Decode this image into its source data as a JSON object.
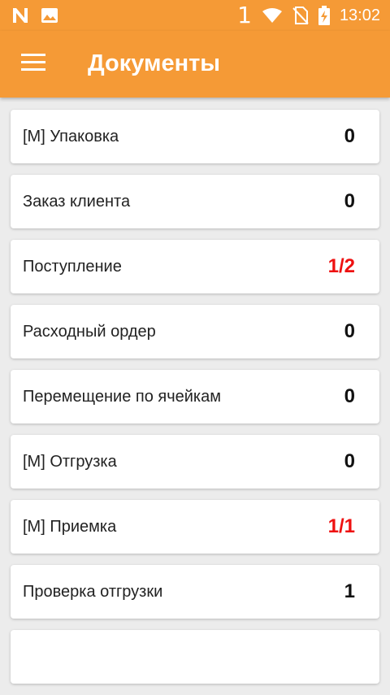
{
  "status_bar": {
    "notification_number": "1",
    "time": "13:02",
    "icons": [
      "n-notification-icon",
      "image-notification-icon",
      "wifi-icon",
      "no-sim-icon",
      "battery-charging-icon"
    ]
  },
  "app_bar": {
    "title": "Документы",
    "menu_icon": "hamburger-menu-icon"
  },
  "documents": [
    {
      "label": "[М] Упаковка",
      "count": "0",
      "alert": false
    },
    {
      "label": "Заказ клиента",
      "count": "0",
      "alert": false
    },
    {
      "label": "Поступление",
      "count": "1/2",
      "alert": true
    },
    {
      "label": "Расходный ордер",
      "count": "0",
      "alert": false
    },
    {
      "label": "Перемещение по ячейкам",
      "count": "0",
      "alert": false
    },
    {
      "label": "[М] Отгрузка",
      "count": "0",
      "alert": false
    },
    {
      "label": "[М] Приемка",
      "count": "1/1",
      "alert": true
    },
    {
      "label": "Проверка отгрузки",
      "count": "1",
      "alert": false
    },
    {
      "label": "",
      "count": "",
      "alert": false
    }
  ],
  "colors": {
    "primary": "#f59a36",
    "alert_count": "#ee1111",
    "background": "#ececec"
  }
}
